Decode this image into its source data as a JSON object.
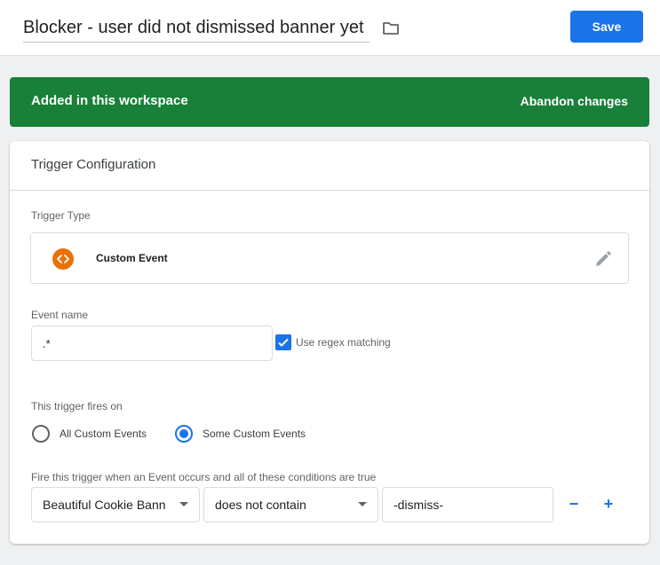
{
  "header": {
    "tag_name": "Blocker - user did not dismissed banner yet",
    "save_label": "Save"
  },
  "banner": {
    "message": "Added in this workspace",
    "abandon_label": "Abandon changes",
    "color": "#188038"
  },
  "card": {
    "title": "Trigger Configuration",
    "trigger_type_label": "Trigger Type",
    "trigger_type_name": "Custom Event",
    "event_name_label": "Event name",
    "event_name_value": ".*",
    "regex_label": "Use regex matching",
    "regex_checked": true,
    "fires_on_label": "This trigger fires on",
    "fires_on_options": [
      {
        "label": "All Custom Events",
        "selected": false
      },
      {
        "label": "Some Custom Events",
        "selected": true
      }
    ],
    "condition_label": "Fire this trigger when an Event occurs and all of these conditions are true",
    "condition": {
      "variable": "Beautiful Cookie Bann",
      "operator": "does not contain",
      "value": "-dismiss-"
    },
    "remove_label": "−",
    "add_label": "+"
  },
  "colors": {
    "accent": "#1a73e8",
    "trigger_icon": "#e8710a"
  },
  "icons": {
    "folder": "folder-icon",
    "trigger_type": "custom-event-icon",
    "edit": "pencil-icon",
    "checkbox": "check-icon"
  }
}
